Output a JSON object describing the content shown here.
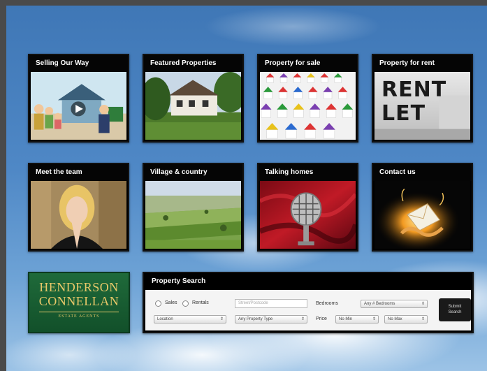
{
  "tiles": [
    {
      "title": "Selling Our Way"
    },
    {
      "title": "Featured Properties"
    },
    {
      "title": "Property for sale"
    },
    {
      "title": "Property for rent"
    },
    {
      "title": "Meet the team"
    },
    {
      "title": "Village & country"
    },
    {
      "title": "Talking homes"
    },
    {
      "title": "Contact us"
    }
  ],
  "rent_image": {
    "line1": "RENT",
    "line2": "LET"
  },
  "logo": {
    "line1": "HENDERSON",
    "line2": "CONNELLAN",
    "line3": "ESTATE AGENTS"
  },
  "search": {
    "title": "Property Search",
    "sales_label": "Sales",
    "rentals_label": "Rentals",
    "keyword_placeholder": "Street/Postcode",
    "bedrooms_label": "Bedrooms",
    "bedrooms_value": "Any # Bedrooms",
    "location_value": "Location",
    "type_value": "Any Property Type",
    "price_label": "Price",
    "min_value": "No Min",
    "max_value": "No Max",
    "submit_line1": "Submit",
    "submit_line2": "Search"
  },
  "colors": {
    "logo_green": "#1f6a3a",
    "logo_gold": "#e8c869",
    "tile_header": "#050505"
  }
}
